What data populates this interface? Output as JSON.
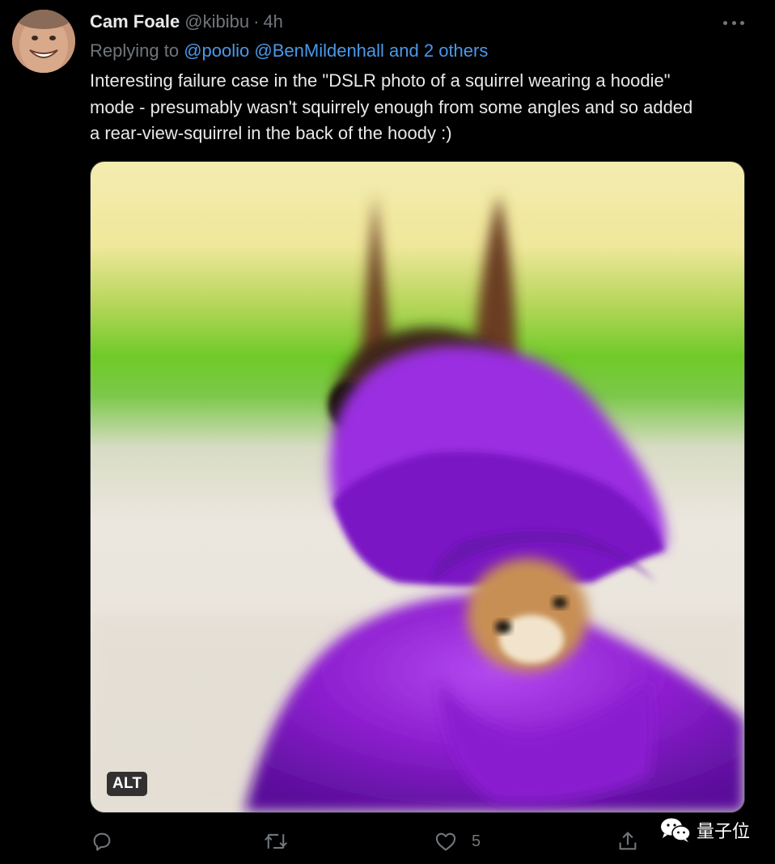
{
  "tweet": {
    "author_name": "Cam Foale",
    "author_handle": "@kibibu",
    "separator": "·",
    "timestamp": "4h",
    "reply_prefix": "Replying to",
    "reply_mentions": [
      "@poolio",
      "@BenMildenhall",
      "and 2 others"
    ],
    "text_lines": [
      "Interesting  failure case in the \"DSLR photo of a squirrel wearing a hoodie\"",
      "mode - presumably wasn't squirrely enough from some angles and so added",
      "a rear-view-squirrel in the back of the hoody :)"
    ],
    "media": {
      "alt_badge": "ALT",
      "icon": "squirrel-in-purple-hoodie-image"
    }
  },
  "actions": {
    "reply": {
      "icon": "reply-icon",
      "count": ""
    },
    "retweet": {
      "icon": "retweet-icon",
      "count": ""
    },
    "like": {
      "icon": "heart-icon",
      "count": "5"
    },
    "share": {
      "icon": "share-icon",
      "count": ""
    }
  },
  "overflow_menu_icon": "more-dots-icon",
  "watermark": {
    "icon": "wechat-icon",
    "text": "量子位"
  },
  "colors": {
    "background": "#000000",
    "primary_text": "#e7e9ea",
    "secondary_text": "#71767b",
    "link": "#4a99e9",
    "hoodie_purple": "#8e1fd0"
  }
}
